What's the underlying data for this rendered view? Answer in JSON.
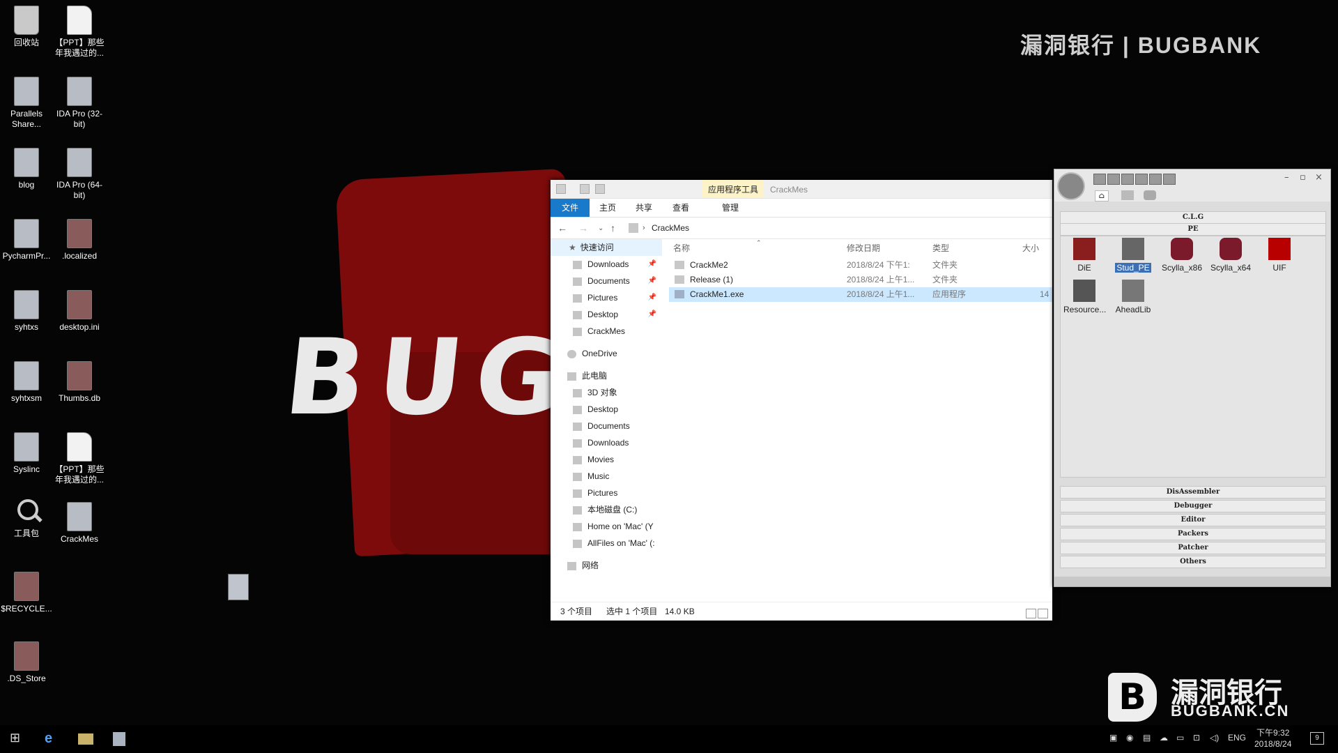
{
  "wallpaper": {
    "text": "BUG",
    "watermark_top": "漏洞银行 | BUGBANK",
    "watermark_logo_letter": "B",
    "watermark_cn": "漏洞银行",
    "watermark_en": "BUGBANK.CN"
  },
  "desktop": {
    "icons": [
      {
        "label": "回收站",
        "icon": "recycle-bin-icon"
      },
      {
        "label": "【PPT】那些年我遇过的...",
        "icon": "document-icon"
      },
      {
        "label": "Parallels Share...",
        "icon": "folder-shortcut-icon"
      },
      {
        "label": "IDA Pro (32-bit)",
        "icon": "app-icon"
      },
      {
        "label": "blog",
        "icon": "folder-icon"
      },
      {
        "label": "IDA Pro (64-bit)",
        "icon": "app-icon"
      },
      {
        "label": "PycharmPr...",
        "icon": "app-icon"
      },
      {
        "label": ".localized",
        "icon": "file-icon"
      },
      {
        "label": "syhtxs",
        "icon": "app-icon"
      },
      {
        "label": "desktop.ini",
        "icon": "settings-file-icon"
      },
      {
        "label": "syhtxsm",
        "icon": "app-icon"
      },
      {
        "label": "Thumbs.db",
        "icon": "file-icon"
      },
      {
        "label": "Syslinc",
        "icon": "app-icon"
      },
      {
        "label": "【PPT】那些年我遇过的...",
        "icon": "document-icon"
      },
      {
        "label": "工具包",
        "icon": "search-icon"
      },
      {
        "label": "CrackMes",
        "icon": "folder-icon"
      },
      {
        "label": "$RECYCLE...",
        "icon": "file-icon"
      },
      {
        "label": ".DS_Store",
        "icon": "file-icon"
      }
    ]
  },
  "explorer": {
    "title": "CrackMes",
    "context_tab": "应用程序工具",
    "ribbon": {
      "file": "文件",
      "home": "主页",
      "share": "共享",
      "view": "查看",
      "manage": "管理"
    },
    "address": {
      "path": "CrackMes"
    },
    "nav": {
      "quick_access": "快速访问",
      "qa_items": [
        {
          "label": "Downloads",
          "pinned": true
        },
        {
          "label": "Documents",
          "pinned": true
        },
        {
          "label": "Pictures",
          "pinned": true
        },
        {
          "label": "Desktop",
          "pinned": true
        },
        {
          "label": "CrackMes",
          "pinned": false
        }
      ],
      "onedrive": "OneDrive",
      "this_pc": "此电脑",
      "pc_items": [
        "3D 对象",
        "Desktop",
        "Documents",
        "Downloads",
        "Movies",
        "Music",
        "Pictures",
        "本地磁盘 (C:)",
        "Home on 'Mac' (Y",
        "AllFiles on 'Mac' (:"
      ],
      "network": "网络"
    },
    "columns": {
      "name": "名称",
      "date": "修改日期",
      "type": "类型",
      "size": "大小"
    },
    "files": [
      {
        "name": "CrackMe2",
        "date": "2018/8/24 下午1:",
        "type": "文件夹",
        "size": ""
      },
      {
        "name": "Release (1)",
        "date": "2018/8/24 上午1...",
        "type": "文件夹",
        "size": ""
      },
      {
        "name": "CrackMe1.exe",
        "date": "2018/8/24 上午1...",
        "type": "应用程序",
        "size": "14"
      }
    ],
    "status": {
      "count": "3 个项目",
      "selected": "选中 1 个项目",
      "size": "14.0 KB"
    }
  },
  "toolbox": {
    "sections_top": [
      "C.L.G",
      "PE"
    ],
    "tools": [
      {
        "label": "DiE",
        "icon": "die-icon",
        "color": "#8a1d1d"
      },
      {
        "label": "Stud_PE",
        "icon": "stud-pe-icon",
        "color": "#666666"
      },
      {
        "label": "Scylla_x86",
        "icon": "scylla-icon",
        "color": "#7a1a2a"
      },
      {
        "label": "Scylla_x64",
        "icon": "scylla-icon",
        "color": "#7a1a2a"
      },
      {
        "label": "UIF",
        "icon": "uif-icon",
        "color": "#b80000"
      },
      {
        "label": "Resource...",
        "icon": "resource-hacker-icon",
        "color": "#555555"
      },
      {
        "label": "AheadLib",
        "icon": "aheadlib-icon",
        "color": "#777777"
      }
    ],
    "sections_bottom": [
      "DisAssembler",
      "Debugger",
      "Editor",
      "Packers",
      "Patcher",
      "Others"
    ]
  },
  "taskbar": {
    "tray_lang": "ENG",
    "clock_time": "下午9:32",
    "clock_date": "2018/8/24",
    "notify_count": "9"
  }
}
